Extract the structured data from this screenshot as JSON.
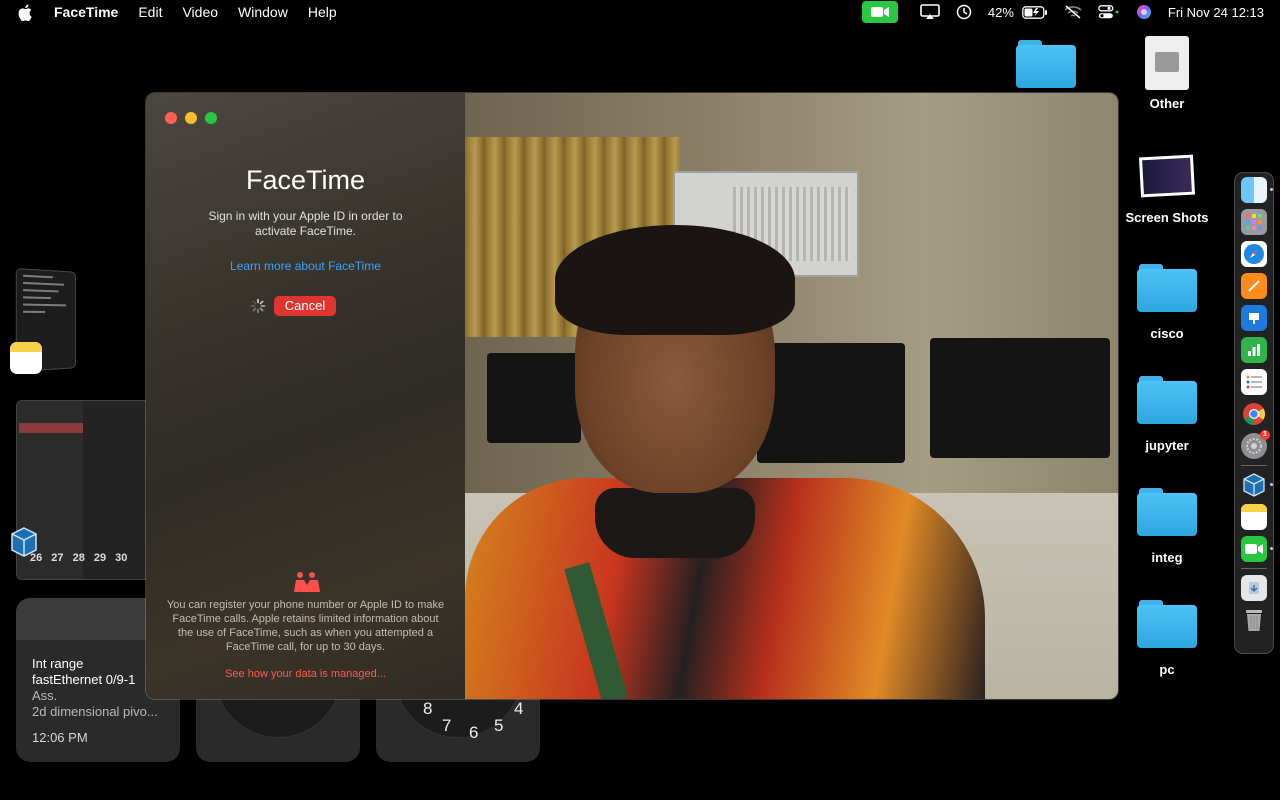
{
  "menubar": {
    "app_name": "FaceTime",
    "menus": [
      "Edit",
      "Video",
      "Window",
      "Help"
    ],
    "battery": "42%",
    "datetime": "Fri Nov 24  12:13"
  },
  "desktop_items": [
    {
      "label": "",
      "icon": "folder-icon"
    },
    {
      "label": "Other",
      "icon": "disk-icon"
    },
    {
      "label": "Screen Shots",
      "icon": "screenshot-stack-icon"
    },
    {
      "label": "cisco",
      "icon": "folder-icon"
    },
    {
      "label": "jupyter",
      "icon": "folder-icon"
    },
    {
      "label": "integ",
      "icon": "folder-icon"
    },
    {
      "label": "pc",
      "icon": "folder-icon"
    }
  ],
  "dock": {
    "apps": [
      "finder-icon",
      "launchpad-icon",
      "safari-icon",
      "pages-icon",
      "keynote-icon",
      "numbers-icon",
      "reminders-icon",
      "chrome-icon",
      "settings-icon",
      "virtualbox-icon",
      "notes-icon",
      "facetime-icon",
      "downloads-icon",
      "trash-icon"
    ],
    "settings_badge": "1"
  },
  "widgets": {
    "notes": {
      "line1": "Int range",
      "line2": "fastEthernet 0/9-1",
      "line3": "Ass.",
      "line4": "2d dimensional pivo...",
      "time": "12:06 PM"
    },
    "clock_numbers": [
      "8",
      "7",
      "6",
      "5",
      "4"
    ],
    "calendar_days": "26 27 28 29 30"
  },
  "facetime": {
    "title": "FaceTime",
    "subtitle": "Sign in with your Apple ID in order to activate FaceTime.",
    "learn_more": "Learn more about FaceTime",
    "cancel": "Cancel",
    "privacy_text": "You can register your phone number or Apple ID to make FaceTime calls. Apple retains limited information about the use of FaceTime, such as when you attempted a FaceTime call, for up to 30 days.",
    "data_link": "See how your data is managed..."
  },
  "colors": {
    "accent_link": "#3aa2ff",
    "cancel_red": "#e0352f",
    "folder_blue": "#2ea7e0",
    "facetime_green": "#28c840"
  }
}
